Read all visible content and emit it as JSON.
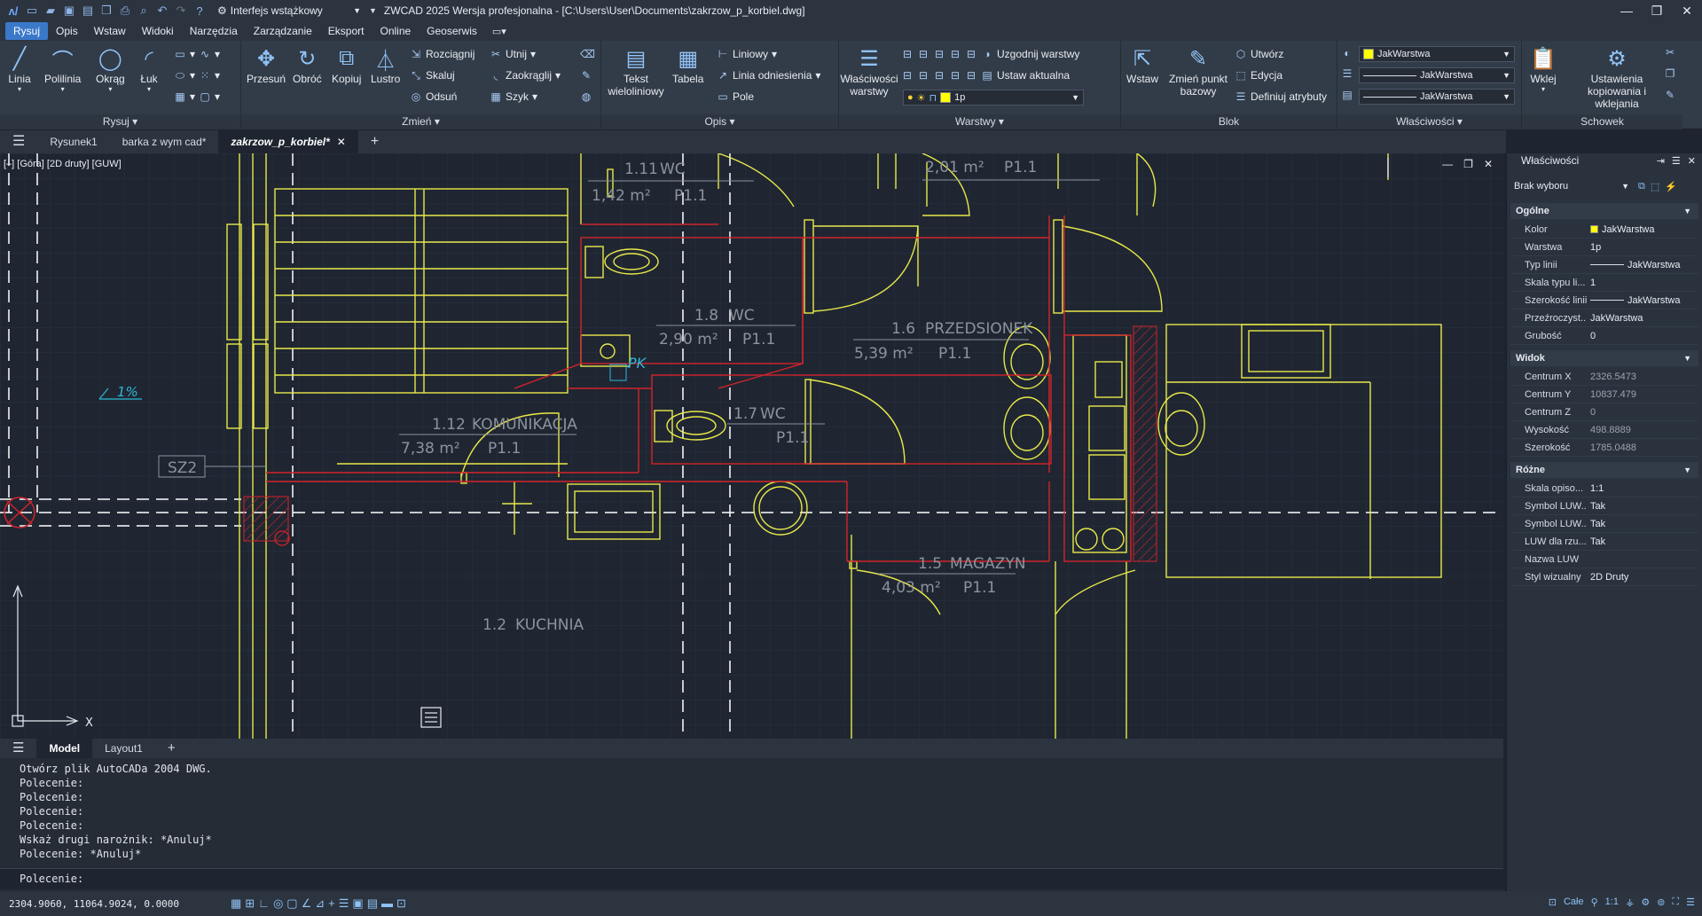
{
  "app": {
    "title": "ZWCAD 2025 Wersja profesjonalna - [C:\\Users\\User\\Documents\\zakrzow_p_korbiel.dwg]",
    "workspace": "Interfejs wstążkowy"
  },
  "menu": [
    "Rysuj",
    "Opis",
    "Wstaw",
    "Widoki",
    "Narzędzia",
    "Zarządzanie",
    "Eksport",
    "Online",
    "Geoserwis"
  ],
  "ribbon": {
    "rysuj": {
      "title": "Rysuj",
      "linia": "Linia",
      "polilinia": "Polilinia",
      "okrag": "Okrąg",
      "luk": "Łuk"
    },
    "zmien": {
      "title": "Zmień",
      "przesun": "Przesuń",
      "obroc": "Obróć",
      "kopiuj": "Kopiuj",
      "lustro": "Lustro",
      "rozciagnij": "Rozciągnij",
      "skaluj": "Skaluj",
      "odsun": "Odsuń",
      "utnij": "Utnij",
      "zaokraglij": "Zaokrąglij",
      "szyk": "Szyk"
    },
    "opis": {
      "title": "Opis",
      "tekst": "Tekst wieloliniowy",
      "tabela": "Tabela",
      "liniowy": "Liniowy",
      "linia_odn": "Linia odniesienia",
      "pole": "Pole"
    },
    "warstwy": {
      "title": "Warstwy",
      "wlasciwosci": "Właściwości warstwy",
      "uzgodnij": "Uzgodnij warstwy",
      "ustaw": "Ustaw aktualna",
      "current_layer": "1p"
    },
    "blok": {
      "title": "Blok",
      "wstaw": "Wstaw",
      "zmien_punkt": "Zmień punkt bazowy",
      "utworz": "Utwórz",
      "edycja": "Edycja",
      "definiuj": "Definiuj atrybuty"
    },
    "wlasciwosci": {
      "title": "Właściwości",
      "kolor": "JakWarstwa",
      "typ": "JakWarstwa",
      "szer": "JakWarstwa"
    },
    "schowek": {
      "title": "Schowek",
      "wklej": "Wklej",
      "ustawienia": "Ustawienia kopiowania i wklejania"
    }
  },
  "doc_tabs": [
    "Rysunek1",
    "barka z wym cad*",
    "zakrzow_p_korbiel*"
  ],
  "viewport": {
    "label": "[–] [Góra] [2D druty] [GUW]"
  },
  "drawing_labels": {
    "room_1_11": "1.11",
    "room_1_11_name": "WC",
    "room_1_11_area": "1,42 m²",
    "room_1_11_code": "P1.1",
    "room_top_area": "2,01 m²",
    "room_top_code": "P1.1",
    "room_1_8": "1.8",
    "room_1_8_name": "WC",
    "room_1_8_area": "2,90 m²",
    "room_1_8_code": "P1.1",
    "room_1_6": "1.6",
    "room_1_6_name": "PRZEDSIONEK",
    "room_1_6_area": "5,39 m²",
    "room_1_6_code": "P1.1",
    "room_1_12": "1.12",
    "room_1_12_name": "KOMUNIKACJA",
    "room_1_12_area": "7,38 m²",
    "room_1_12_code": "P1.1",
    "room_1_7": "1.7",
    "room_1_7_name": "WC",
    "room_1_7_code": "P1.1",
    "room_1_5": "1.5",
    "room_1_5_name": "MAGAZYN",
    "room_1_5_area": "4,03 m²",
    "room_1_5_code": "P1.1",
    "room_1_2": "1.2",
    "room_1_2_name": "KUCHNIA",
    "pk": "PK",
    "slope": "1%",
    "sz2": "SZ2",
    "axis_x": "X"
  },
  "layout_tabs": [
    "Model",
    "Layout1"
  ],
  "command_history": [
    "Otwórz plik AutoCADa 2004 DWG.",
    "Polecenie:",
    "Polecenie:",
    "Polecenie:",
    "Polecenie:",
    "Wskaż drugi narożnik: *Anuluj*",
    "Polecenie: *Anuluj*"
  ],
  "command_prompt": "Polecenie:",
  "status": {
    "coords": "2304.9060, 11064.9024, 0.0000",
    "scale_label": "Całe",
    "scale": "1:1"
  },
  "properties": {
    "title": "Właściwości",
    "selection": "Brak wyboru",
    "sections": {
      "ogolne": "Ogólne",
      "widok": "Widok",
      "rozne": "Różne"
    },
    "ogolne": [
      {
        "k": "Kolor",
        "v": "JakWarstwa"
      },
      {
        "k": "Warstwa",
        "v": "1p"
      },
      {
        "k": "Typ linii",
        "v": "JakWarstwa"
      },
      {
        "k": "Skala typu li...",
        "v": "1"
      },
      {
        "k": "Szerokość linii",
        "v": "JakWarstwa"
      },
      {
        "k": "Przeźroczyst...",
        "v": "JakWarstwa"
      },
      {
        "k": "Grubość",
        "v": "0"
      }
    ],
    "widok": [
      {
        "k": "Centrum X",
        "v": "2326.5473"
      },
      {
        "k": "Centrum Y",
        "v": "10837.479"
      },
      {
        "k": "Centrum Z",
        "v": "0"
      },
      {
        "k": "Wysokość",
        "v": "498.8889"
      },
      {
        "k": "Szerokość",
        "v": "1785.0488"
      }
    ],
    "rozne": [
      {
        "k": "Skala opiso...",
        "v": "1:1"
      },
      {
        "k": "Symbol LUW...",
        "v": "Tak"
      },
      {
        "k": "Symbol LUW...",
        "v": "Tak"
      },
      {
        "k": "LUW dla rzu...",
        "v": "Tak"
      },
      {
        "k": "Nazwa LUW",
        "v": ""
      },
      {
        "k": "Styl wizualny",
        "v": "2D Druty"
      }
    ]
  },
  "colors": {
    "accent": "#3a78c9",
    "wall_yellow": "#e8e84a",
    "wall_red": "#d2232a",
    "canvas": "#1f2632"
  }
}
